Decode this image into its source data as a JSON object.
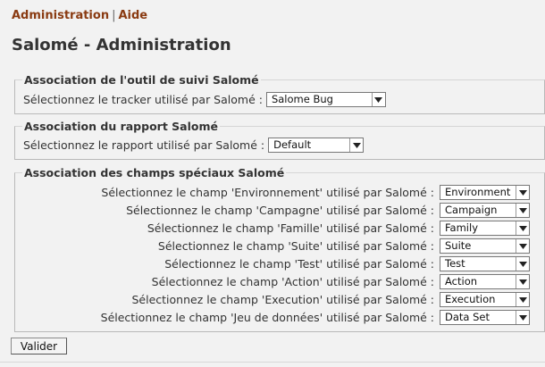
{
  "nav": {
    "admin_label": "Administration",
    "separator": "|",
    "help_label": "Aide"
  },
  "page_title": "Salomé - Administration",
  "tracker_section": {
    "legend": "Association de l'outil de suivi Salomé",
    "label": "Sélectionnez le tracker utilisé par Salomé :",
    "value": "Salome Bug"
  },
  "report_section": {
    "legend": "Association du rapport Salomé",
    "label": "Sélectionnez le rapport utilisé par Salomé :",
    "value": "Default"
  },
  "special_fields_section": {
    "legend": "Association des champs spéciaux Salomé",
    "rows": [
      {
        "label": "Sélectionnez le champ 'Environnement' utilisé par Salomé :",
        "value": "Environment"
      },
      {
        "label": "Sélectionnez le champ 'Campagne' utilisé par Salomé :",
        "value": "Campaign"
      },
      {
        "label": "Sélectionnez le champ 'Famille' utilisé par Salomé :",
        "value": "Family"
      },
      {
        "label": "Sélectionnez le champ 'Suite' utilisé par Salomé :",
        "value": "Suite"
      },
      {
        "label": "Sélectionnez le champ 'Test' utilisé par Salomé :",
        "value": "Test"
      },
      {
        "label": "Sélectionnez le champ 'Action' utilisé par Salomé :",
        "value": "Action"
      },
      {
        "label": "Sélectionnez le champ 'Execution' utilisé par Salomé :",
        "value": "Execution"
      },
      {
        "label": "Sélectionnez le champ 'Jeu de données' utilisé par Salomé :",
        "value": "Data Set"
      }
    ]
  },
  "submit_label": "Valider",
  "colors": {
    "nav_link": "#8a3b12",
    "background": "#f2f2f2"
  }
}
